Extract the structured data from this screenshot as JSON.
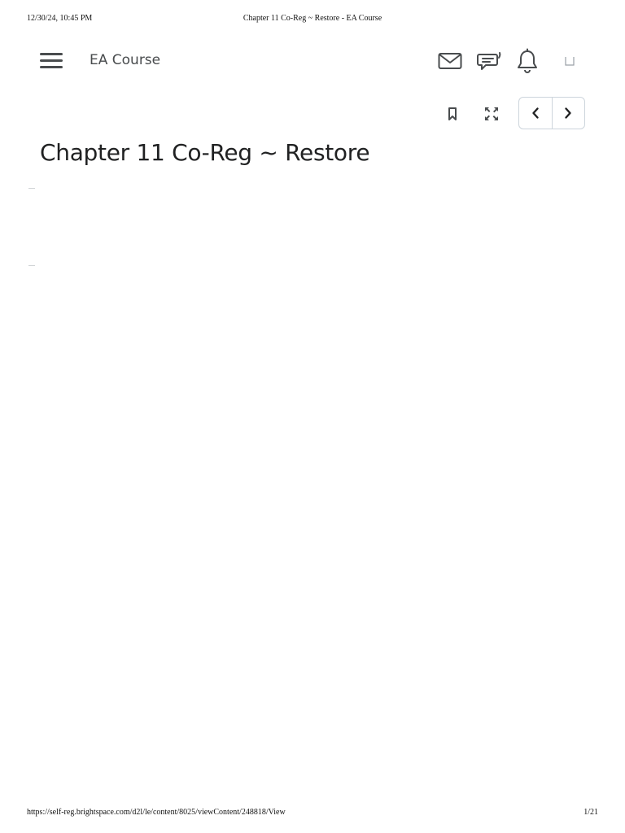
{
  "print_header": {
    "datetime": "12/30/24, 10:45 PM",
    "document_title": "Chapter 11 Co-Reg ~ Restore - EA Course"
  },
  "navbar": {
    "course_name": "EA Course",
    "icons": {
      "menu": "hamburger-menu-icon",
      "mail": "mail-icon",
      "chat": "chat-icon",
      "notifications": "bell-icon",
      "user": "user-menu-icon"
    }
  },
  "toolbar": {
    "icons": {
      "bookmark": "bookmark-icon",
      "fullscreen": "fullscreen-icon",
      "previous": "chevron-left-icon",
      "next": "chevron-right-icon"
    }
  },
  "content": {
    "title": "Chapter 11 Co-Reg ~ Restore"
  },
  "print_footer": {
    "url": "https://self-reg.brightspace.com/d2l/le/content/8025/viewContent/248818/View",
    "page_indicator": "1/21"
  },
  "colors": {
    "icon": "#494c4e",
    "text": "#202122",
    "border": "#cdd5dc"
  }
}
